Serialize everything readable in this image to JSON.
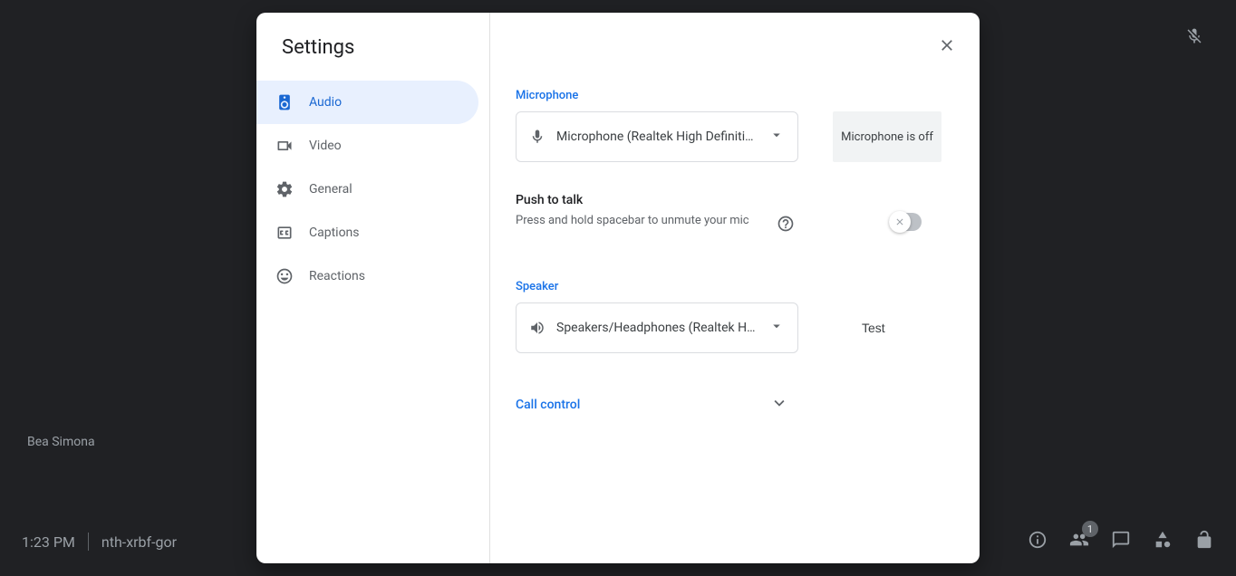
{
  "background": {
    "participant_name": "Bea Simona"
  },
  "bottom_bar": {
    "time": "1:23 PM",
    "meeting_code": "nth-xrbf-gor",
    "people_badge": "1"
  },
  "modal": {
    "title": "Settings",
    "nav": {
      "audio": "Audio",
      "video": "Video",
      "general": "General",
      "captions": "Captions",
      "reactions": "Reactions"
    },
    "audio_panel": {
      "mic_label": "Microphone",
      "mic_selected": "Microphone (Realtek High Definitio…",
      "mic_status": "Microphone is off",
      "push_title": "Push to talk",
      "push_desc": "Press and hold spacebar to unmute your mic",
      "speaker_label": "Speaker",
      "speaker_selected": "Speakers/Headphones (Realtek Hig…",
      "test_button": "Test",
      "call_control": "Call control"
    }
  }
}
